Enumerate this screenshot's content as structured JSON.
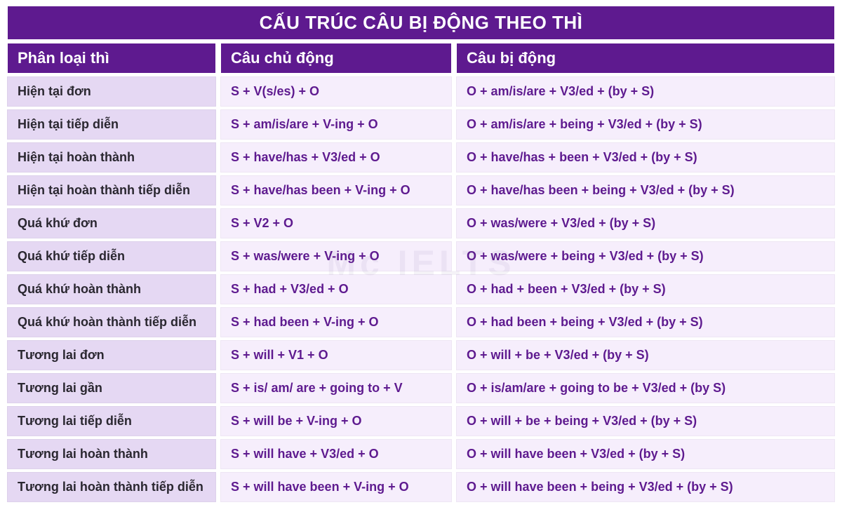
{
  "title": "CẤU TRÚC CÂU BỊ ĐỘNG THEO THÌ",
  "headers": {
    "col1": "Phân loại thì",
    "col2": "Câu chủ động",
    "col3": "Câu bị động"
  },
  "rows": [
    {
      "tense": "Hiện tại đơn",
      "active": "S + V(s/es) + O",
      "passive": "O + am/is/are + V3/ed + (by + S)"
    },
    {
      "tense": "Hiện tại tiếp diễn",
      "active": "S + am/is/are + V-ing + O",
      "passive": "O + am/is/are + being + V3/ed + (by + S)"
    },
    {
      "tense": "Hiện tại hoàn thành",
      "active": "S + have/has + V3/ed + O",
      "passive": "O + have/has + been + V3/ed + (by + S)"
    },
    {
      "tense": "Hiện tại hoàn thành tiếp diễn",
      "active": "S + have/has been + V-ing + O",
      "passive": "O + have/has been + being + V3/ed + (by + S)"
    },
    {
      "tense": "Quá khứ đơn",
      "active": "S + V2 + O",
      "passive": "O + was/were + V3/ed + (by + S)"
    },
    {
      "tense": "Quá khứ tiếp diễn",
      "active": "S + was/were + V-ing + O",
      "passive": "O + was/were + being + V3/ed + (by + S)"
    },
    {
      "tense": "Quá khứ hoàn thành",
      "active": "S + had + V3/ed + O",
      "passive": "O + had + been + V3/ed + (by + S)"
    },
    {
      "tense": "Quá khứ hoàn thành tiếp diễn",
      "active": "S + had been + V-ing + O",
      "passive": "O + had been + being + V3/ed + (by + S)"
    },
    {
      "tense": "Tương lai đơn",
      "active": "S + will + V1 + O",
      "passive": "O + will + be + V3/ed + (by + S)"
    },
    {
      "tense": "Tương lai gần",
      "active": "S + is/ am/ are + going to + V",
      "passive": "O + is/am/are + going to be + V3/ed + (by S)"
    },
    {
      "tense": "Tương lai tiếp diễn",
      "active": "S + will be + V-ing + O",
      "passive": "O + will + be + being + V3/ed + (by + S)"
    },
    {
      "tense": "Tương lai hoàn thành",
      "active": "S + will have + V3/ed + O",
      "passive": "O + will have been + V3/ed + (by + S)"
    },
    {
      "tense": "Tương lai hoàn thành tiếp diễn",
      "active": "S + will have been + V-ing + O",
      "passive": "O + will have been + being + V3/ed + (by + S)"
    }
  ],
  "watermark": "Mc IELTS"
}
